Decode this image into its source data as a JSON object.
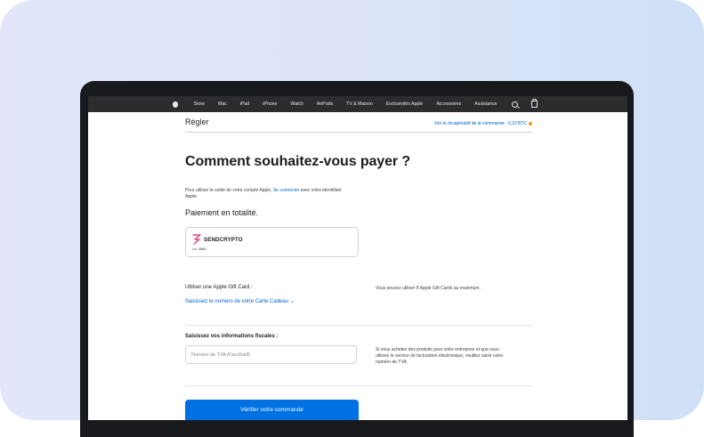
{
  "nav": {
    "items": [
      "Store",
      "Mac",
      "iPad",
      "iPhone",
      "Watch",
      "AirPods",
      "TV & Maison",
      "Exclusivités Apple",
      "Accessoires",
      "Assistance"
    ]
  },
  "subheader": {
    "title": "Régler",
    "summary_link": "Voir le récapitulatif de la commande : 0,10 BTC"
  },
  "page": {
    "title": "Comment souhaitez-vous payer ?",
    "account_note_before": "Pour utiliser le solde de votre compte Apple, ",
    "account_note_link": "Se connecter",
    "account_note_after": " avec votre identifiant Apple.",
    "full_payment_heading": "Paiement en totalité."
  },
  "payment_method": {
    "name": "SENDCRYPTO",
    "masked_number": "•••• 3866"
  },
  "gift_card": {
    "label": "Utiliser une Apple Gift Card :",
    "link": "Saisissez le numéro de votre Carte Cadeau ⌄",
    "note": "Vous pouvez utiliser 8 Apple Gift Cards au maximum."
  },
  "fiscal": {
    "label": "Saisissez vos informations fiscales :",
    "input_placeholder": "Numéro de TVA (Facultatif)",
    "input_value": "",
    "note": "Si vous achetez des produits pour votre entreprise et que vous utilisez le service de facturation électronique, veuillez saisir votre numéro de TVA."
  },
  "actions": {
    "verify_button": "Vérifier votre commande"
  },
  "colors": {
    "accent": "#0071e3",
    "link": "#0066cc",
    "nav_bg": "#2c2c2e",
    "btc": "#f7931a",
    "sendcrypto_logo": "#e0497a"
  },
  "icons": [
    "apple-logo-icon",
    "search-icon",
    "bag-icon",
    "bitcoin-icon",
    "sendcrypto-logo-icon"
  ]
}
